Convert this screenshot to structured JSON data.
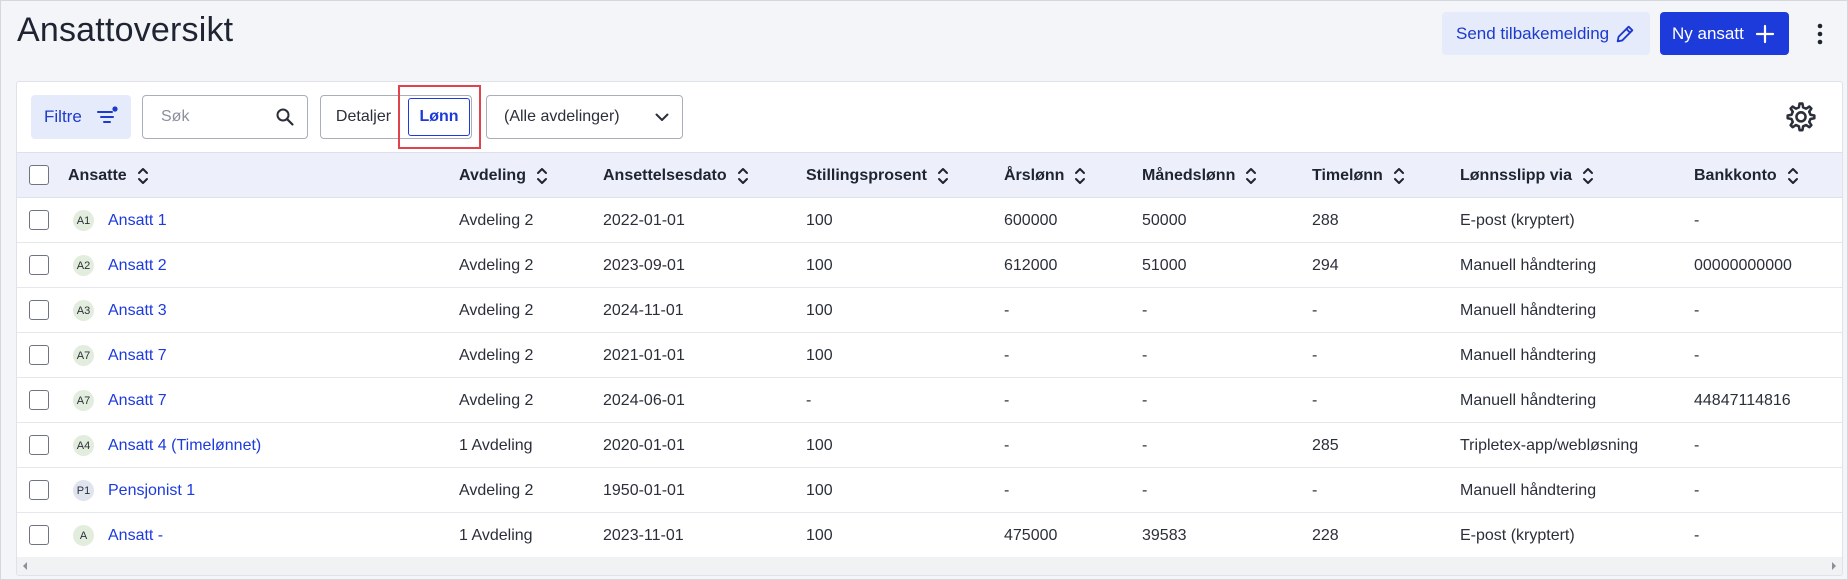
{
  "page": {
    "title": "Ansattoversikt"
  },
  "header": {
    "feedback_label": "Send tilbakemelding",
    "new_employee_label": "Ny ansatt"
  },
  "toolbar": {
    "filter_label": "Filtre",
    "search_placeholder": "Søk",
    "search_value": "",
    "view_details_label": "Detaljer",
    "view_salary_label": "Lønn",
    "active_view": "Lønn",
    "department_select_value": "(Alle avdelinger)"
  },
  "table": {
    "columns": [
      "Ansatte",
      "Avdeling",
      "Ansettelsesdato",
      "Stillingsprosent",
      "Årslønn",
      "Månedslønn",
      "Timelønn",
      "Lønnsslipp via",
      "Bankkonto"
    ],
    "rows": [
      {
        "initials": "A1",
        "name": "Ansatt 1",
        "department": "Avdeling 2",
        "start_date": "2022-01-01",
        "percent": "100",
        "annual": "600000",
        "monthly": "50000",
        "hourly": "288",
        "payslip": "E-post (kryptert)",
        "bank": "-"
      },
      {
        "initials": "A2",
        "name": "Ansatt 2",
        "department": "Avdeling 2",
        "start_date": "2023-09-01",
        "percent": "100",
        "annual": "612000",
        "monthly": "51000",
        "hourly": "294",
        "payslip": "Manuell håndtering",
        "bank": "00000000000"
      },
      {
        "initials": "A3",
        "name": "Ansatt 3",
        "department": "Avdeling 2",
        "start_date": "2024-11-01",
        "percent": "100",
        "annual": "-",
        "monthly": "-",
        "hourly": "-",
        "payslip": "Manuell håndtering",
        "bank": "-"
      },
      {
        "initials": "A7",
        "name": "Ansatt 7",
        "department": "Avdeling 2",
        "start_date": "2021-01-01",
        "percent": "100",
        "annual": "-",
        "monthly": "-",
        "hourly": "-",
        "payslip": "Manuell håndtering",
        "bank": "-"
      },
      {
        "initials": "A7",
        "name": "Ansatt 7",
        "department": "Avdeling 2",
        "start_date": "2024-06-01",
        "percent": "-",
        "annual": "-",
        "monthly": "-",
        "hourly": "-",
        "payslip": "Manuell håndtering",
        "bank": "44847114816"
      },
      {
        "initials": "A4",
        "name": "Ansatt 4 (Timelønnet)",
        "department": "1 Avdeling",
        "start_date": "2020-01-01",
        "percent": "100",
        "annual": "-",
        "monthly": "-",
        "hourly": "285",
        "payslip": "Tripletex-app/webløsning",
        "bank": "-"
      },
      {
        "initials": "P1",
        "name": "Pensjonist 1",
        "department": "Avdeling 2",
        "start_date": "1950-01-01",
        "percent": "100",
        "annual": "-",
        "monthly": "-",
        "hourly": "-",
        "payslip": "Manuell håndtering",
        "bank": "-"
      },
      {
        "initials": "A",
        "name": "Ansatt -",
        "department": "1 Avdeling",
        "start_date": "2023-11-01",
        "percent": "100",
        "annual": "475000",
        "monthly": "39583",
        "hourly": "228",
        "payslip": "E-post (kryptert)",
        "bank": "-"
      }
    ]
  },
  "colors": {
    "accent": "#1d3adb",
    "accent_light": "#e6ebfb",
    "header_bg": "#edf0fb",
    "avatar_green": "#e2eddd",
    "avatar_blue": "#dfe4ee",
    "highlight_red": "#e0434b"
  },
  "icons": {
    "feedback": "pencil-icon",
    "new": "plus-icon",
    "more": "kebab-menu-icon",
    "filter": "filter-icon",
    "search": "search-icon",
    "dropdown": "chevron-down-icon",
    "settings": "gear-icon",
    "sort": "sort-arrows-icon"
  }
}
